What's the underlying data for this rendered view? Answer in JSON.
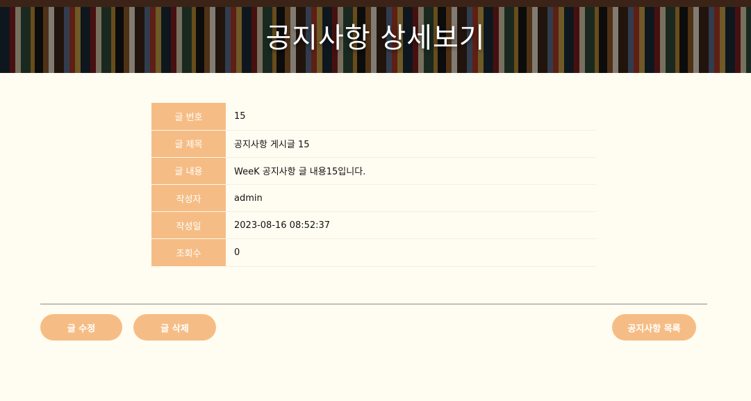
{
  "banner": {
    "title": "공지사항 상세보기"
  },
  "notice": {
    "rows": [
      {
        "label": "글 번호",
        "value": "15"
      },
      {
        "label": "글 제목",
        "value": "공지사항 게시글 15"
      },
      {
        "label": "글 내용",
        "value": "WeeK 공지사항 글 내용15입니다."
      },
      {
        "label": "작성자",
        "value": "admin"
      },
      {
        "label": "작성일",
        "value": "2023-08-16 08:52:37"
      },
      {
        "label": "조회수",
        "value": "0"
      }
    ]
  },
  "actions": {
    "edit_label": "글 수정",
    "delete_label": "글 삭제",
    "list_label": "공지사항 목록"
  },
  "colors": {
    "accent": "#f5bd85",
    "background": "#fffcf1",
    "divider": "#8f8a80"
  }
}
